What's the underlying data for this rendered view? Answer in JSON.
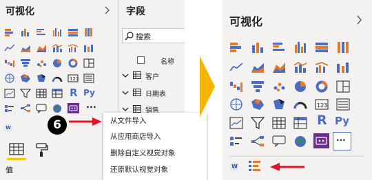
{
  "left_pane": {
    "title": "可视化",
    "chevron": "chevron-right-icon",
    "r_glyph": "R",
    "py_glyph": "Py",
    "more_glyph": "...",
    "values_label": "值"
  },
  "fields_pane": {
    "title": "字段",
    "search_placeholder": "搜索",
    "name_header": "名称",
    "tables": [
      {
        "name": "客户"
      },
      {
        "name": "日期表"
      },
      {
        "name": "销售"
      }
    ]
  },
  "step_badge": "6",
  "context_menu": {
    "items": [
      "从文件导入",
      "从应用商店导入",
      "删除自定义视觉对象",
      "还原默认视觉对象"
    ]
  },
  "right_pane": {
    "title": "可视化",
    "chevron": "chevron-right-icon",
    "r_glyph": "R",
    "py_glyph": "Py",
    "more_glyph": "···"
  },
  "colors": {
    "accent_yellow": "#f2c811",
    "arrow_red": "#e81123",
    "transition_arrow": "#f5b400",
    "pane_bg": "#f3f2f1"
  }
}
